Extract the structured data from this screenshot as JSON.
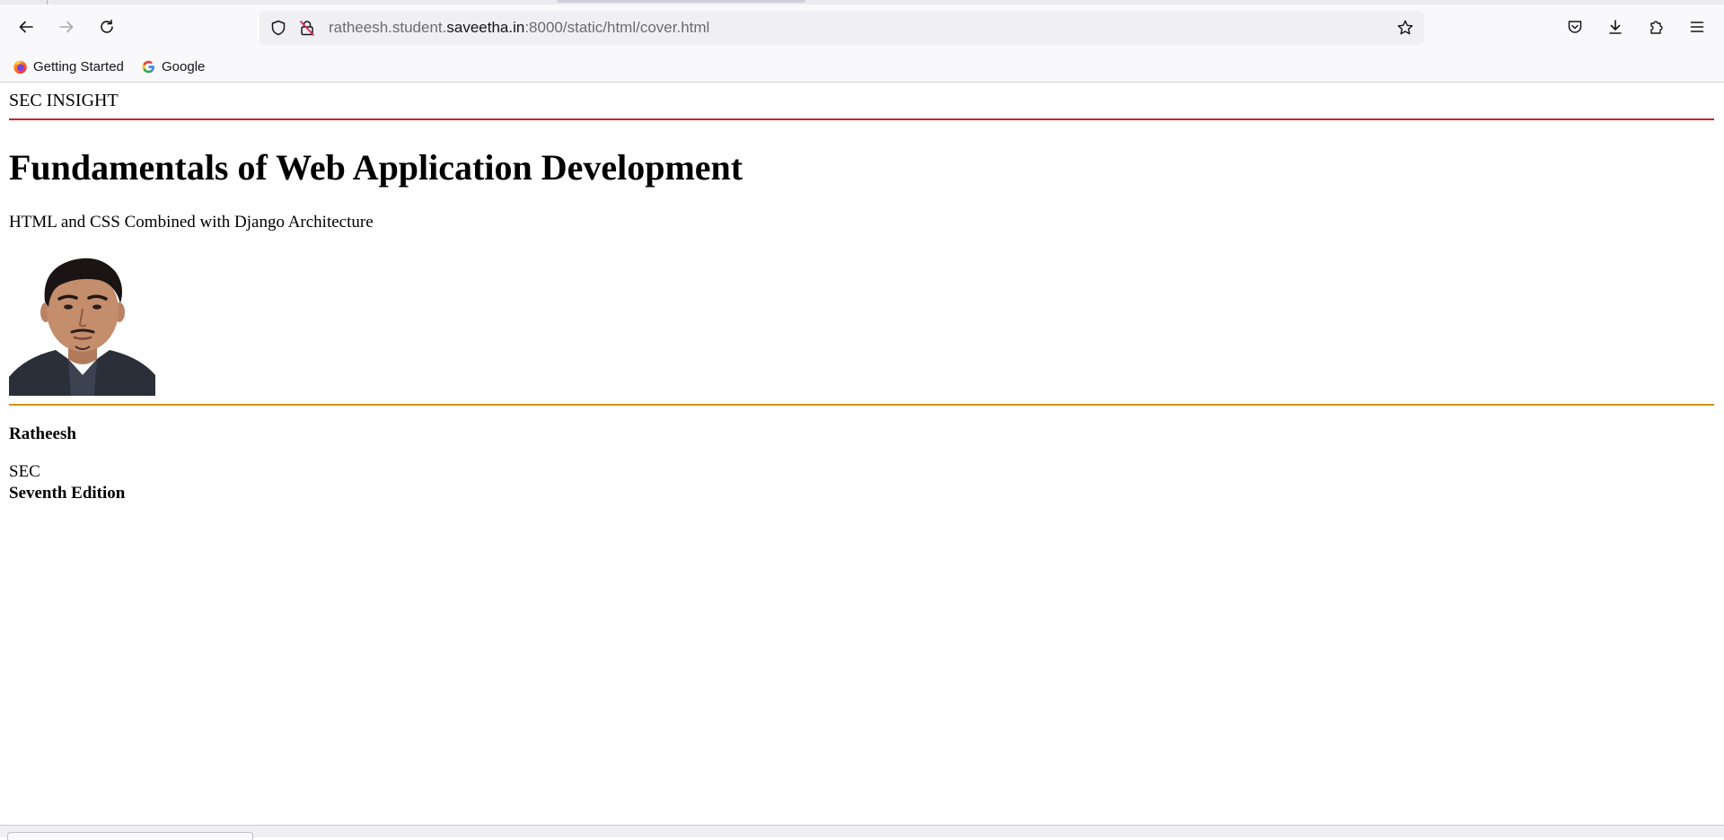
{
  "browser": {
    "url_prefix": "ratheesh.student.",
    "url_domain": "saveetha.in",
    "url_suffix": ":8000/static/html/cover.html",
    "bookmarks": [
      {
        "label": "Getting Started",
        "icon": "firefox-icon"
      },
      {
        "label": "Google",
        "icon": "google-icon"
      }
    ],
    "toolbar_icons": [
      "back-arrow-icon",
      "forward-arrow-icon",
      "reload-icon",
      "shield-icon",
      "insecure-lock-icon",
      "star-icon",
      "pocket-icon",
      "download-icon",
      "extensions-icon",
      "menu-icon"
    ]
  },
  "page": {
    "brand": "SEC INSIGHT",
    "title": "Fundamentals of Web Application Development",
    "subtitle": "HTML and CSS Combined with Django Architecture",
    "author": "Ratheesh",
    "org": "SEC",
    "edition": "Seventh Edition"
  },
  "colors": {
    "rule_top": "#c8252b",
    "rule_bottom": "#d4930f",
    "chrome_bg": "#f9f9fb",
    "urlbar_bg": "#f0f0f4"
  }
}
